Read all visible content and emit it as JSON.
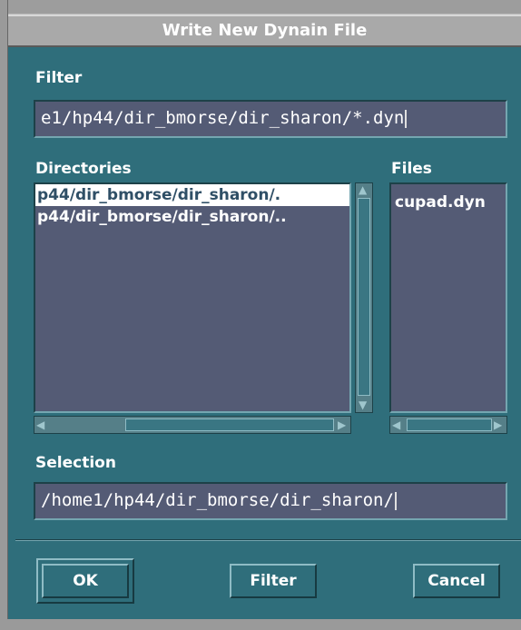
{
  "window": {
    "title": "Write New Dynain File"
  },
  "filter": {
    "label": "Filter",
    "value": "e1/hp44/dir_bmorse/dir_sharon/*.dyn"
  },
  "directories": {
    "label": "Directories",
    "items": [
      {
        "label": "p44/dir_bmorse/dir_sharon/.",
        "selected": true
      },
      {
        "label": "p44/dir_bmorse/dir_sharon/..",
        "selected": false
      }
    ]
  },
  "files": {
    "label": "Files",
    "items": [
      {
        "label": "cupad.dyn"
      }
    ]
  },
  "selection": {
    "label": "Selection",
    "value": "/home1/hp44/dir_bmorse/dir_sharon/"
  },
  "buttons": {
    "ok": "OK",
    "filter": "Filter",
    "cancel": "Cancel"
  },
  "colors": {
    "dialog_bg": "#2f6e7b",
    "list_bg": "#545b75",
    "title_bar": "#a9a9a9"
  },
  "icons": {
    "up": "arrow-up-icon",
    "down": "arrow-down-icon",
    "left": "arrow-left-icon",
    "right": "arrow-right-icon"
  }
}
